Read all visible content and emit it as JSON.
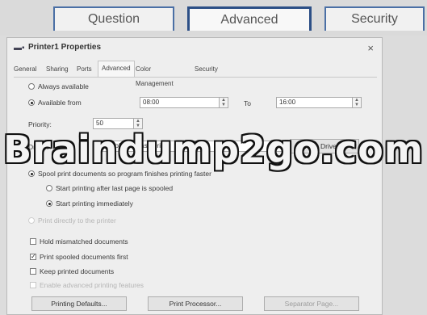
{
  "top_tabs": [
    "Question",
    "Advanced",
    "Security"
  ],
  "dialog": {
    "title": "Printer1 Properties",
    "title_icon": "printer-icon",
    "close_label": "×",
    "tabs": [
      "General",
      "Sharing",
      "Ports",
      "Advanced",
      "Color Management",
      "Security"
    ],
    "active_tab": "Advanced",
    "always_available_label": "Always available",
    "available_from_label": "Available from",
    "from_time": "08:00",
    "to_label": "To",
    "to_time": "16:00",
    "priority_label": "Priority:",
    "priority_value": "50",
    "driver_label": "Driver:",
    "driver_value": "Microsoft PS Class Driver",
    "new_driver_label": "New Driver...",
    "spool_label": "Spool print documents so program finishes printing faster",
    "start_after_last_label": "Start printing after last page is spooled",
    "start_immediately_label": "Start printing immediately",
    "print_directly_label": "Print directly to the printer",
    "hold_mismatched_label": "Hold mismatched documents",
    "print_spooled_first_label": "Print spooled documents first",
    "keep_printed_label": "Keep printed documents",
    "enable_advanced_label": "Enable advanced printing features",
    "printing_defaults_label": "Printing Defaults...",
    "print_processor_label": "Print Processor...",
    "separator_page_label": "Separator Page..."
  },
  "watermark": "Braindump2go.com"
}
